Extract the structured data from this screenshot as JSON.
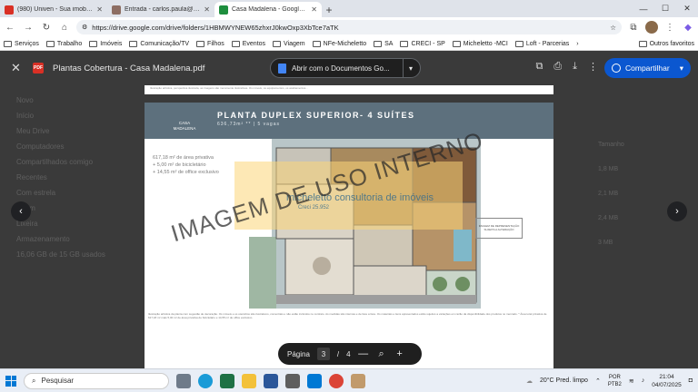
{
  "browser": {
    "tabs": [
      {
        "label": "(980) Univen - Sua imobiliária e",
        "color": "#d93025",
        "active": false
      },
      {
        "label": "Entrada - carlos.paula@michelett",
        "color": "#8d6e63",
        "active": false
      },
      {
        "label": "Casa Madalena - Google Drive",
        "color": "#1e8e3e",
        "active": true
      }
    ],
    "new_tab": "+",
    "window_controls": [
      "—",
      "☐",
      "✕"
    ],
    "url": "https://drive.google.com/drive/folders/1HBMWYNEW65zhxrJ0kwOxp3XbTce7aTK",
    "bookmarks": [
      "Serviços",
      "Trabalho",
      "Imóveis",
      "Comunicação/TV",
      "Filhos",
      "Eventos",
      "Viagem",
      "NFe-Micheletto",
      "SA",
      "CRECI - SP",
      "Micheletto -MCI",
      "Loft - Parcerias"
    ],
    "bookmarks_more": "›",
    "other_bookmarks": "Outros favoritos"
  },
  "viewer": {
    "close_icon": "✕",
    "file_badge": "PDF",
    "file_title": "Plantas Cobertura - Casa Madalena.pdf",
    "open_with_label": "Abrir com o Documentos Go...",
    "dropdown_icon": "▾",
    "share_label": "Compartilhar",
    "prev_arrow": "‹",
    "next_arrow": "›",
    "page_controls": {
      "page_label": "Página",
      "current_page": "3",
      "separator": "/",
      "total_pages": "4",
      "zoom_out": "—",
      "zoom_in": "+"
    }
  },
  "drive_background": {
    "left_items": [
      "Novo",
      "Início",
      "Meu Drive",
      "Computadores",
      "Compartilhados comigo",
      "Recentes",
      "Com estrela",
      "Spam",
      "Lixeira",
      "Armazenamento"
    ],
    "storage": "16,06 GB de 15 GB usados",
    "right_items": [
      "Tamanho",
      "1,8 MB",
      "2,1 MB",
      "2,4 MB",
      "3 MB"
    ]
  },
  "pdf_page": {
    "top_strip_text": "Ilustração artística, perspectiva ilustrada, as imagens são meramente ilustrativas. Os móveis, os equipamentos, os acabamentos...",
    "title": "PLANTA DUPLEX SUPERIOR- 4 SUÍTES",
    "subtitle": "636,73m² ** | 5 vagas",
    "brand": "CASA MADALENA",
    "areas": [
      "617,18 m² de área privativa",
      "+ 5,00 m² de bicicletário",
      "+ 14,55 m² de office exclusivo"
    ],
    "note_box": "IMAGEM DE REPRESENTAÇÃO SUJEITA A ALTERAÇÃO",
    "footnote": "Ilustração artística da planta com sugestão de decoração. Os móveis e os utensílios são ilustrativos, comerciais e não estão incluídos no contrato. As medidas são internas e de face a face. Os materiais e itens apresentados estão sujeitos a variações em razão da disponibilidade dos produtos no mercado. * Área total privativa de 617,18 m² mais 5,00 m² de área privativa de bicicletário e 14,55 m² de office exclusivo.",
    "watermark": "IMAGEM DE USO INTERNO",
    "logo_text": "micheletto consultoria de imóveis",
    "logo_sub": "Creci 25.952"
  },
  "taskbar": {
    "search_placeholder": "Pesquisar",
    "weather": "20°C  Pred. limpo",
    "lang_top": "POR",
    "lang_bottom": "PTB2",
    "time": "21:04",
    "date": "04/07/2025"
  },
  "colors": {
    "accent": "#0b57d0",
    "viewer_bg": "#3a3a3a",
    "banner": "#5d707d"
  }
}
